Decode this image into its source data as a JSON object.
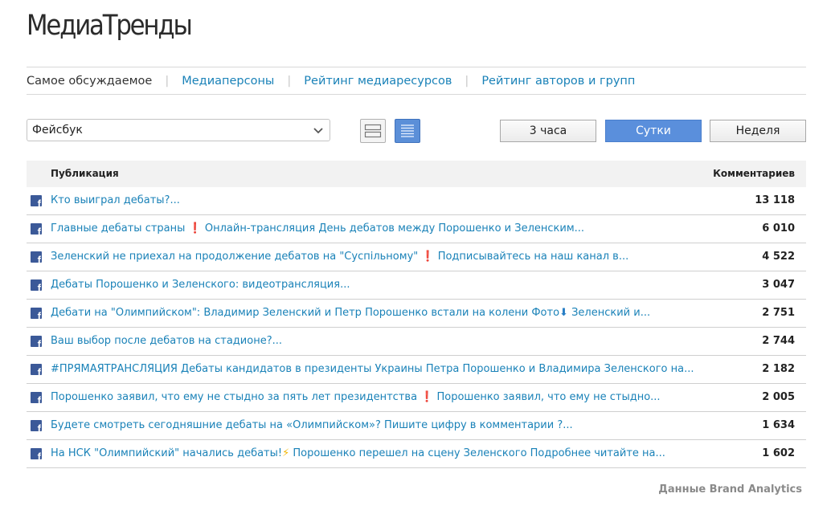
{
  "app": {
    "title": "МедиаТренды"
  },
  "nav": {
    "items": [
      {
        "label": "Самое обсуждаемое",
        "active": true
      },
      {
        "label": "Медиаперсоны",
        "active": false
      },
      {
        "label": "Рейтинг медиаресурсов",
        "active": false
      },
      {
        "label": "Рейтинг авторов и групп",
        "active": false
      }
    ],
    "separator": "|"
  },
  "source_select": {
    "value": "Фейсбук"
  },
  "view_toggle": {
    "active": "list",
    "icons": [
      "two-rows-icon",
      "list-icon"
    ]
  },
  "period_buttons": [
    {
      "label": "3 часа",
      "active": false
    },
    {
      "label": "Сутки",
      "active": true
    },
    {
      "label": "Неделя",
      "active": false
    }
  ],
  "table": {
    "headers": {
      "publication": "Публикация",
      "comments": "Комментариев"
    },
    "rows": [
      {
        "source_icon": "facebook-icon",
        "text": "Кто выиграл дебаты?...",
        "count": "13 118"
      },
      {
        "source_icon": "facebook-icon",
        "text_a": "Главные дебаты страны ",
        "emoji": "❗",
        "text_b": " Онлайн-трансляция День дебатов между Порошенко и Зеленским...",
        "count": "6 010"
      },
      {
        "source_icon": "facebook-icon",
        "text_a": "Зеленский не приехал на продолжение дебатов на \"Суспільному\" ",
        "emoji": "❗",
        "text_b": " Подписывайтесь на наш канал в...",
        "count": "4 522"
      },
      {
        "source_icon": "facebook-icon",
        "text": "Дебаты Порошенко и Зеленского: видеотрансляция...",
        "count": "3 047"
      },
      {
        "source_icon": "facebook-icon",
        "text_a": "Дебати на \"Олимпийском\": Владимир Зеленский и Петр Порошенко встали на колени Фото",
        "emoji": "⬇",
        "text_b": " Зеленский и...",
        "count": "2 751"
      },
      {
        "source_icon": "facebook-icon",
        "text": "Ваш выбор после дебатов на стадионе?...",
        "count": "2 744"
      },
      {
        "source_icon": "facebook-icon",
        "text": "#ПРЯМАЯТРАНСЛЯЦИЯ Дебаты кандидатов в президенты Украины Петра Порошенко и Владимира Зеленского на...",
        "count": "2 182"
      },
      {
        "source_icon": "facebook-icon",
        "text_a": "Порошенко заявил, что ему не стыдно за пять лет президентства ",
        "emoji": "❗",
        "text_b": " Порошенко заявил, что ему не стыдно...",
        "count": "2 005"
      },
      {
        "source_icon": "facebook-icon",
        "text": "Будете смотреть сегодняшние дебаты на «Олимпийском»? Пишите цифру в комментарии ?...",
        "count": "1 634"
      },
      {
        "source_icon": "facebook-icon",
        "text_a": "На НСК \"Олимпийский\" начались дебаты!",
        "emoji": "⚡",
        "text_b": " Порошенко перешел на сцену Зеленского Подробнее читайте на...",
        "count": "1 602"
      }
    ]
  },
  "footer": {
    "credit": "Данные Brand Analytics"
  },
  "colors": {
    "link": "#1a82b8",
    "accent_button": "#5a8fdc",
    "facebook": "#3b5998",
    "alert": "#e0202a"
  }
}
